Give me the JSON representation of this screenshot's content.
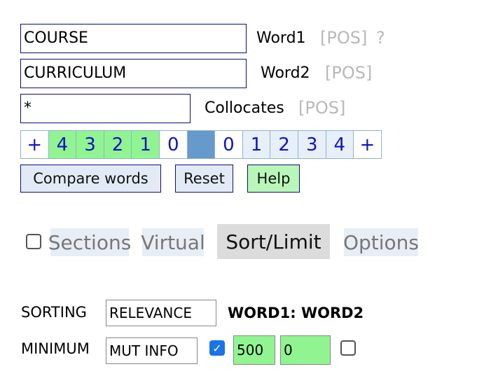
{
  "inputs": {
    "word1": {
      "value": "COURSE",
      "label": "Word1",
      "pos": "[POS]",
      "help": "?"
    },
    "word2": {
      "value": "CURRICULUM",
      "label": "Word2",
      "pos": "[POS]"
    },
    "collocates": {
      "value": "*",
      "label": "Collocates",
      "pos": "[POS]"
    }
  },
  "span": {
    "left": [
      {
        "label": "+",
        "bg": "#ffffff"
      },
      {
        "label": "4",
        "bg": "#90f590"
      },
      {
        "label": "3",
        "bg": "#90f590"
      },
      {
        "label": "2",
        "bg": "#90f590"
      },
      {
        "label": "1",
        "bg": "#90f590"
      },
      {
        "label": "0",
        "bg": "#ffffff"
      }
    ],
    "center_color": "#6699cc",
    "right": [
      {
        "label": "0",
        "bg": "#ffffff"
      },
      {
        "label": "1",
        "bg": "#e7f0f8"
      },
      {
        "label": "2",
        "bg": "#e7f0f8"
      },
      {
        "label": "3",
        "bg": "#e7f0f8"
      },
      {
        "label": "4",
        "bg": "#e7f0f8"
      },
      {
        "label": "+",
        "bg": "#ffffff"
      }
    ]
  },
  "buttons": {
    "compare": "Compare words",
    "reset": "Reset",
    "help": "Help"
  },
  "tabs": {
    "sections": "Sections",
    "virtual": "Virtual",
    "sort_limit": "Sort/Limit",
    "options": "Options",
    "sections_checked": false
  },
  "sorting": {
    "label": "SORTING",
    "value": "RELEVANCE",
    "heading": "WORD1: WORD2"
  },
  "minimum": {
    "label": "MINIMUM",
    "value": "MUT INFO",
    "checked": true,
    "freq": "500",
    "score": "0",
    "checked2": false
  },
  "colors": {
    "green": "#90f590",
    "blue_btn": "#e2ebf5",
    "accent": "#1a73e8"
  }
}
